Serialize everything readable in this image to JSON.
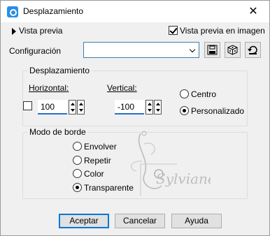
{
  "window": {
    "title": "Desplazamiento",
    "close_glyph": "✕"
  },
  "preview": {
    "toggle_label": "Vista previa",
    "image_label": "Vista previa en imagen",
    "image_checked": true
  },
  "config": {
    "label": "Configuración",
    "value": ""
  },
  "icons": [
    "save-icon",
    "random-dice-icon",
    "reset-icon"
  ],
  "offset_group": {
    "title": "Desplazamiento",
    "horizontal_label": "Horizontal:",
    "horizontal_value": "100",
    "vertical_label": "Vertical:",
    "vertical_value": "-100",
    "center_label": "Centro",
    "custom_label": "Personalizado",
    "selected": "Personalizado"
  },
  "border_group": {
    "title": "Modo de borde",
    "options": [
      "Envolver",
      "Repetir",
      "Color",
      "Transparente"
    ],
    "selected": "Transparente"
  },
  "buttons": {
    "ok": "Aceptar",
    "cancel": "Cancelar",
    "help": "Ayuda"
  },
  "watermark_text": "Sylviane",
  "colors": {
    "accent": "#0078d7",
    "input_underline": "#2a6fc9",
    "icon_blue": "#2a8ee6"
  }
}
